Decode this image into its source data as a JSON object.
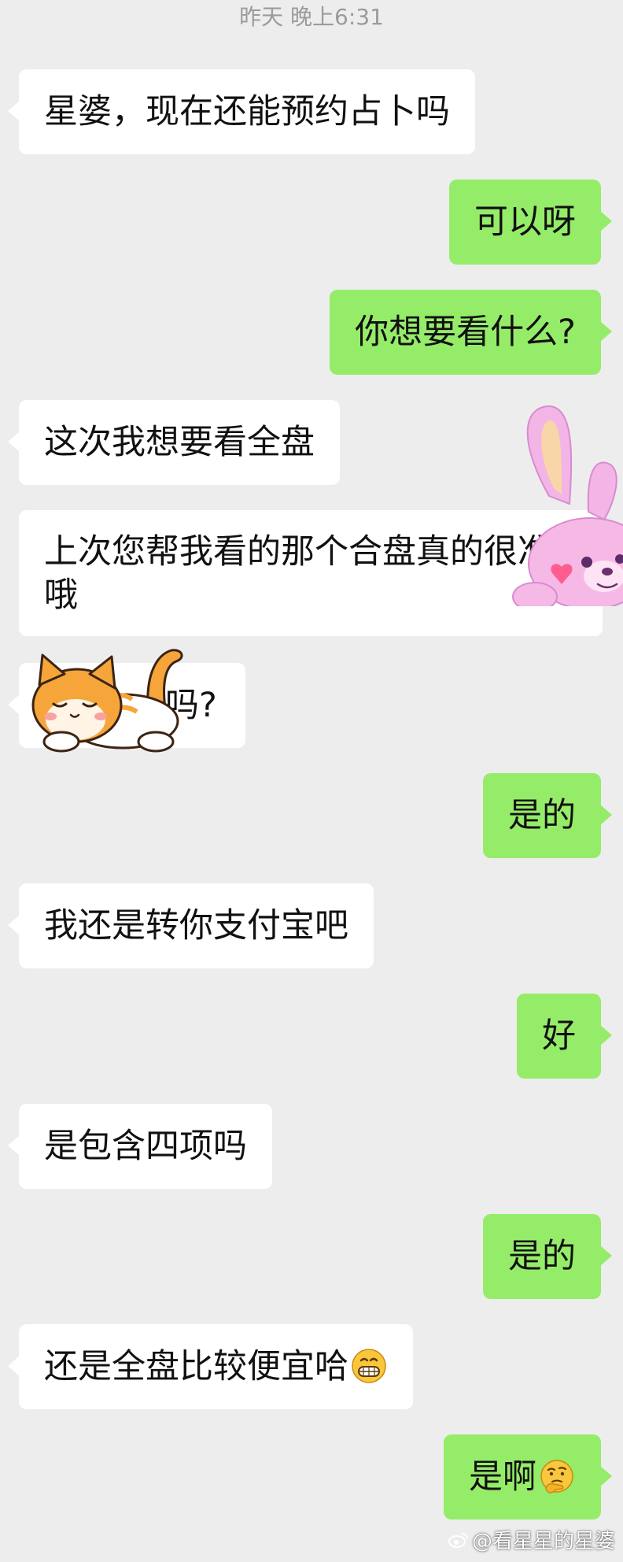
{
  "timestamp": "昨天 晚上6:31",
  "messages": [
    {
      "side": "left",
      "text": "星婆，现在还能预约占卜吗"
    },
    {
      "side": "right",
      "text": "可以呀"
    },
    {
      "side": "right",
      "text": "你想要看什么?"
    },
    {
      "side": "left",
      "text": "这次我想要看全盘"
    },
    {
      "side": "left",
      "text": "上次您帮我看的那个合盘真的很准哦"
    },
    {
      "side": "left",
      "text": "吗?"
    },
    {
      "side": "right",
      "text": "是的"
    },
    {
      "side": "left",
      "text": "我还是转你支付宝吧"
    },
    {
      "side": "right",
      "text": "好"
    },
    {
      "side": "left",
      "text": "是包含四项吗"
    },
    {
      "side": "right",
      "text": "是的"
    },
    {
      "side": "left",
      "text": "还是全盘比较便宜哈",
      "emoji": "grinning-face-emoji"
    },
    {
      "side": "right",
      "text": "是啊",
      "emoji": "thinking-face-emoji"
    }
  ],
  "stickers": [
    {
      "name": "pink-bunny-sticker"
    },
    {
      "name": "sleeping-cat-sticker"
    }
  ],
  "watermark": {
    "text": "@看星星的星婆",
    "icon": "weibo-icon"
  },
  "colors": {
    "background": "#ededed",
    "left_bubble": "#ffffff",
    "right_bubble": "#95ec69",
    "timestamp": "#9b9b9b"
  }
}
